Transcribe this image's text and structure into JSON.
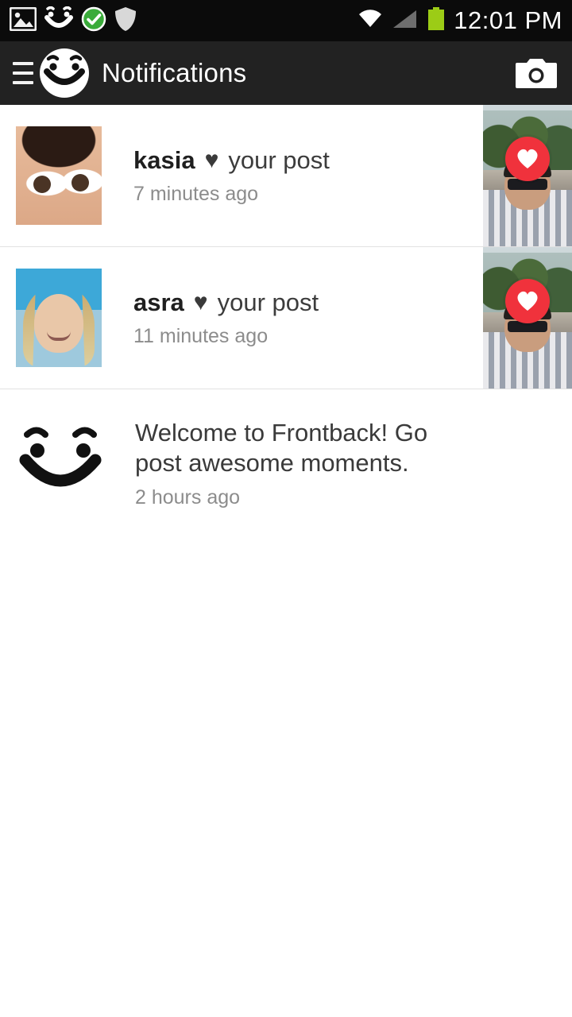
{
  "statusbar": {
    "icons": [
      "gallery-icon",
      "frontback-smiley-icon",
      "checkmark-icon",
      "shield-icon"
    ],
    "right_icons": [
      "wifi-icon",
      "signal-icon",
      "battery-icon"
    ],
    "clock": "12:01 PM"
  },
  "actionbar": {
    "menu_icon": "hamburger-menu-icon",
    "logo_icon": "frontback-logo-icon",
    "title": "Notifications",
    "camera_icon": "camera-icon"
  },
  "notifications": [
    {
      "username": "kasia",
      "heart": "♥",
      "action": "your post",
      "timestamp": "7 minutes ago",
      "thumb_badge": "heart-icon"
    },
    {
      "username": "asra",
      "heart": "♥",
      "action": "your post",
      "timestamp": "11 minutes ago",
      "thumb_badge": "heart-icon"
    }
  ],
  "welcome": {
    "logo_icon": "frontback-smiley-icon",
    "message": "Welcome to Frontback! Go post awesome moments.",
    "timestamp": "2 hours ago"
  },
  "colors": {
    "statusbar_bg": "#0b0b0b",
    "actionbar_bg": "#222222",
    "heart_badge": "#f0323c",
    "battery_green": "#9ccc16",
    "check_green": "#3aab3a",
    "body_text": "#3a3a3a",
    "muted_text": "#8c8c8c"
  }
}
